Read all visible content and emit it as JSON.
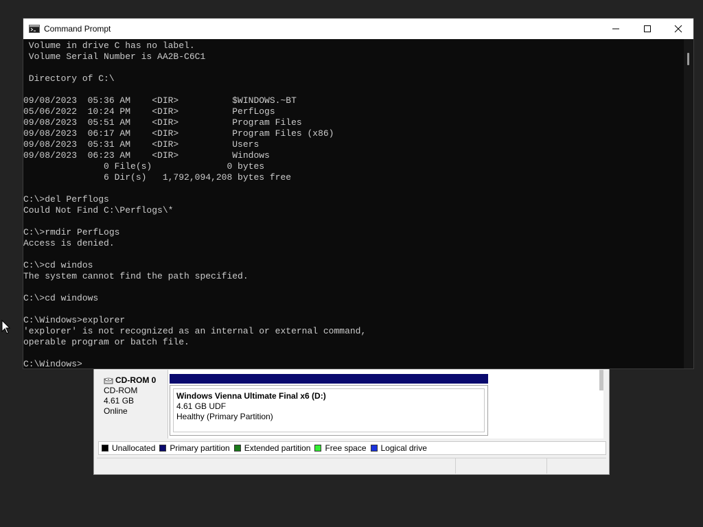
{
  "cmd_window": {
    "title": "Command Prompt",
    "icon": "cmd-icon",
    "buttons": {
      "minimize": "minimize-icon",
      "maximize": "maximize-icon",
      "close": "close-icon"
    },
    "console_lines": [
      " Volume in drive C has no label.",
      " Volume Serial Number is AA2B-C6C1",
      "",
      " Directory of C:\\",
      "",
      "09/08/2023  05:36 AM    <DIR>          $WINDOWS.~BT",
      "05/06/2022  10:24 PM    <DIR>          PerfLogs",
      "09/08/2023  05:51 AM    <DIR>          Program Files",
      "09/08/2023  06:17 AM    <DIR>          Program Files (x86)",
      "09/08/2023  05:31 AM    <DIR>          Users",
      "09/08/2023  06:23 AM    <DIR>          Windows",
      "               0 File(s)              0 bytes",
      "               6 Dir(s)   1,792,094,208 bytes free",
      "",
      "C:\\>del Perflogs",
      "Could Not Find C:\\Perflogs\\*",
      "",
      "C:\\>rmdir PerfLogs",
      "Access is denied.",
      "",
      "C:\\>cd windos",
      "The system cannot find the path specified.",
      "",
      "C:\\>cd windows",
      "",
      "C:\\Windows>explorer",
      "'explorer' is not recognized as an internal or external command,",
      "operable program or batch file.",
      "",
      "C:\\Windows>"
    ]
  },
  "disk_management": {
    "disk": {
      "name": "CD-ROM 0",
      "type": "CD-ROM",
      "size": "4.61 GB",
      "status": "Online",
      "icon": "cdrom-icon"
    },
    "volume": {
      "name": "Windows Vienna Ultimate Final x6  (D:)",
      "fs": "4.61 GB UDF",
      "status": "Healthy (Primary Partition)",
      "bar_color": "#0a0a6e"
    },
    "legend": [
      {
        "label": "Unallocated",
        "color": "#000000"
      },
      {
        "label": "Primary partition",
        "color": "#0a0a6e"
      },
      {
        "label": "Extended partition",
        "color": "#1a7a1a"
      },
      {
        "label": "Free space",
        "color": "#33ee33"
      },
      {
        "label": "Logical drive",
        "color": "#1a33dd"
      }
    ]
  },
  "colors": {
    "desktop": "#232323",
    "console_bg": "#0c0c0c",
    "console_fg": "#cccccc"
  }
}
